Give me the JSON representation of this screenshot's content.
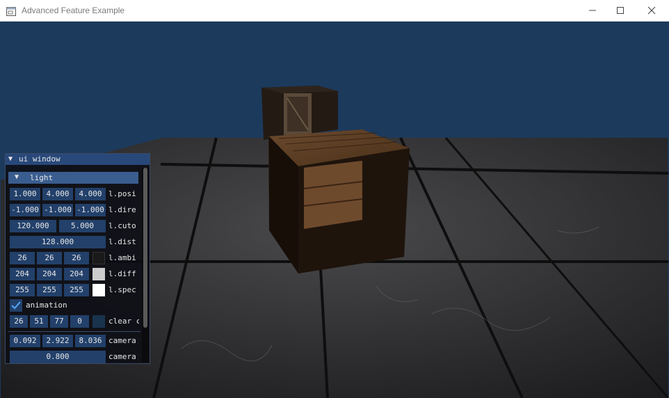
{
  "window": {
    "title": "Advanced Feature Example",
    "controls": [
      "minimize-icon",
      "maximize-icon",
      "close-icon"
    ]
  },
  "ui_window": {
    "title": "ui window",
    "light_section": {
      "header": "light",
      "position": {
        "values": [
          "1.000",
          "4.000",
          "4.000"
        ],
        "label": "l.posi"
      },
      "direction": {
        "values": [
          "-1.000",
          "-1.000",
          "-1.000"
        ],
        "label": "l.dire"
      },
      "cutoff": {
        "values": [
          "120.000",
          "5.000"
        ],
        "label": "l.cuto"
      },
      "distance": {
        "value": "128.000",
        "label": "l.dist"
      },
      "ambient": {
        "values": [
          "26",
          "26",
          "26"
        ],
        "label": "l.ambi",
        "color": "#1a1a1a"
      },
      "diffuse": {
        "values": [
          "204",
          "204",
          "204"
        ],
        "label": "l.diff",
        "color": "#cccccc"
      },
      "specular": {
        "values": [
          "255",
          "255",
          "255"
        ],
        "label": "l.spec",
        "color": "#ffffff"
      }
    },
    "animation": {
      "label": "animation",
      "checked": true
    },
    "clear_color": {
      "values": [
        "26",
        "51",
        "77",
        "0"
      ],
      "label": "clear c",
      "color": "#1a334d"
    },
    "camera_position": {
      "values": [
        "0.092",
        "2.922",
        "8.036"
      ],
      "label": "camera"
    },
    "camera_other": {
      "value": "0.800",
      "label": "camera"
    }
  },
  "colors": {
    "clear_background": "#1c3a5c",
    "widget_frame": "#22406a",
    "header": "#3a5d8f",
    "title_bar_active": "#29487a"
  }
}
